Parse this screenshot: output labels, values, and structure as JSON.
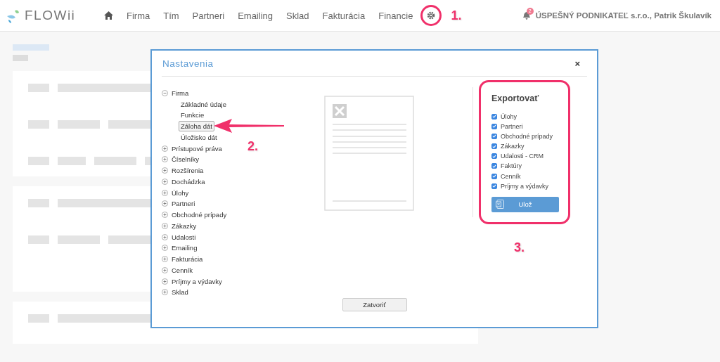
{
  "header": {
    "logo": "FLOWii",
    "nav": [
      {
        "label": "Firma"
      },
      {
        "label": "Tím"
      },
      {
        "label": "Partneri"
      },
      {
        "label": "Emailing"
      },
      {
        "label": "Sklad"
      },
      {
        "label": "Fakturácia"
      },
      {
        "label": "Financie"
      }
    ],
    "notifications": "2",
    "account": "ÚSPEŠNÝ PODNIKATEĽ s.r.o., Patrik Škulavík"
  },
  "dialog": {
    "title": "Nastavenia",
    "close": "×",
    "tree": [
      {
        "label": "Firma",
        "expanded": true,
        "children": [
          {
            "label": "Základné údaje",
            "selected": false
          },
          {
            "label": "Funkcie",
            "selected": false
          },
          {
            "label": "Záloha dát",
            "selected": true
          },
          {
            "label": "Úložisko dát",
            "selected": false
          }
        ]
      },
      {
        "label": "Prístupové práva",
        "expanded": false
      },
      {
        "label": "Číselníky",
        "expanded": false
      },
      {
        "label": "Rozšírenia",
        "expanded": false
      },
      {
        "label": "Dochádzka",
        "expanded": false
      },
      {
        "label": "Úlohy",
        "expanded": false
      },
      {
        "label": "Partneri",
        "expanded": false
      },
      {
        "label": "Obchodné prípady",
        "expanded": false
      },
      {
        "label": "Zákazky",
        "expanded": false
      },
      {
        "label": "Udalosti",
        "expanded": false
      },
      {
        "label": "Emailing",
        "expanded": false
      },
      {
        "label": "Fakturácia",
        "expanded": false
      },
      {
        "label": "Cenník",
        "expanded": false
      },
      {
        "label": "Príjmy a výdavky",
        "expanded": false
      },
      {
        "label": "Sklad",
        "expanded": false
      }
    ],
    "export": {
      "title": "Exportovať",
      "items": [
        {
          "label": "Úlohy",
          "checked": true
        },
        {
          "label": "Partneri",
          "checked": true
        },
        {
          "label": "Obchodné prípady",
          "checked": true
        },
        {
          "label": "Zákazky",
          "checked": true
        },
        {
          "label": "Udalosti - CRM",
          "checked": true
        },
        {
          "label": "Faktúry",
          "checked": true
        },
        {
          "label": "Cenník",
          "checked": true
        },
        {
          "label": "Príjmy a výdavky",
          "checked": true
        }
      ],
      "button": "Ulož"
    },
    "footer_button": "Zatvoriť"
  },
  "annotations": [
    "1.",
    "2.",
    "3."
  ]
}
